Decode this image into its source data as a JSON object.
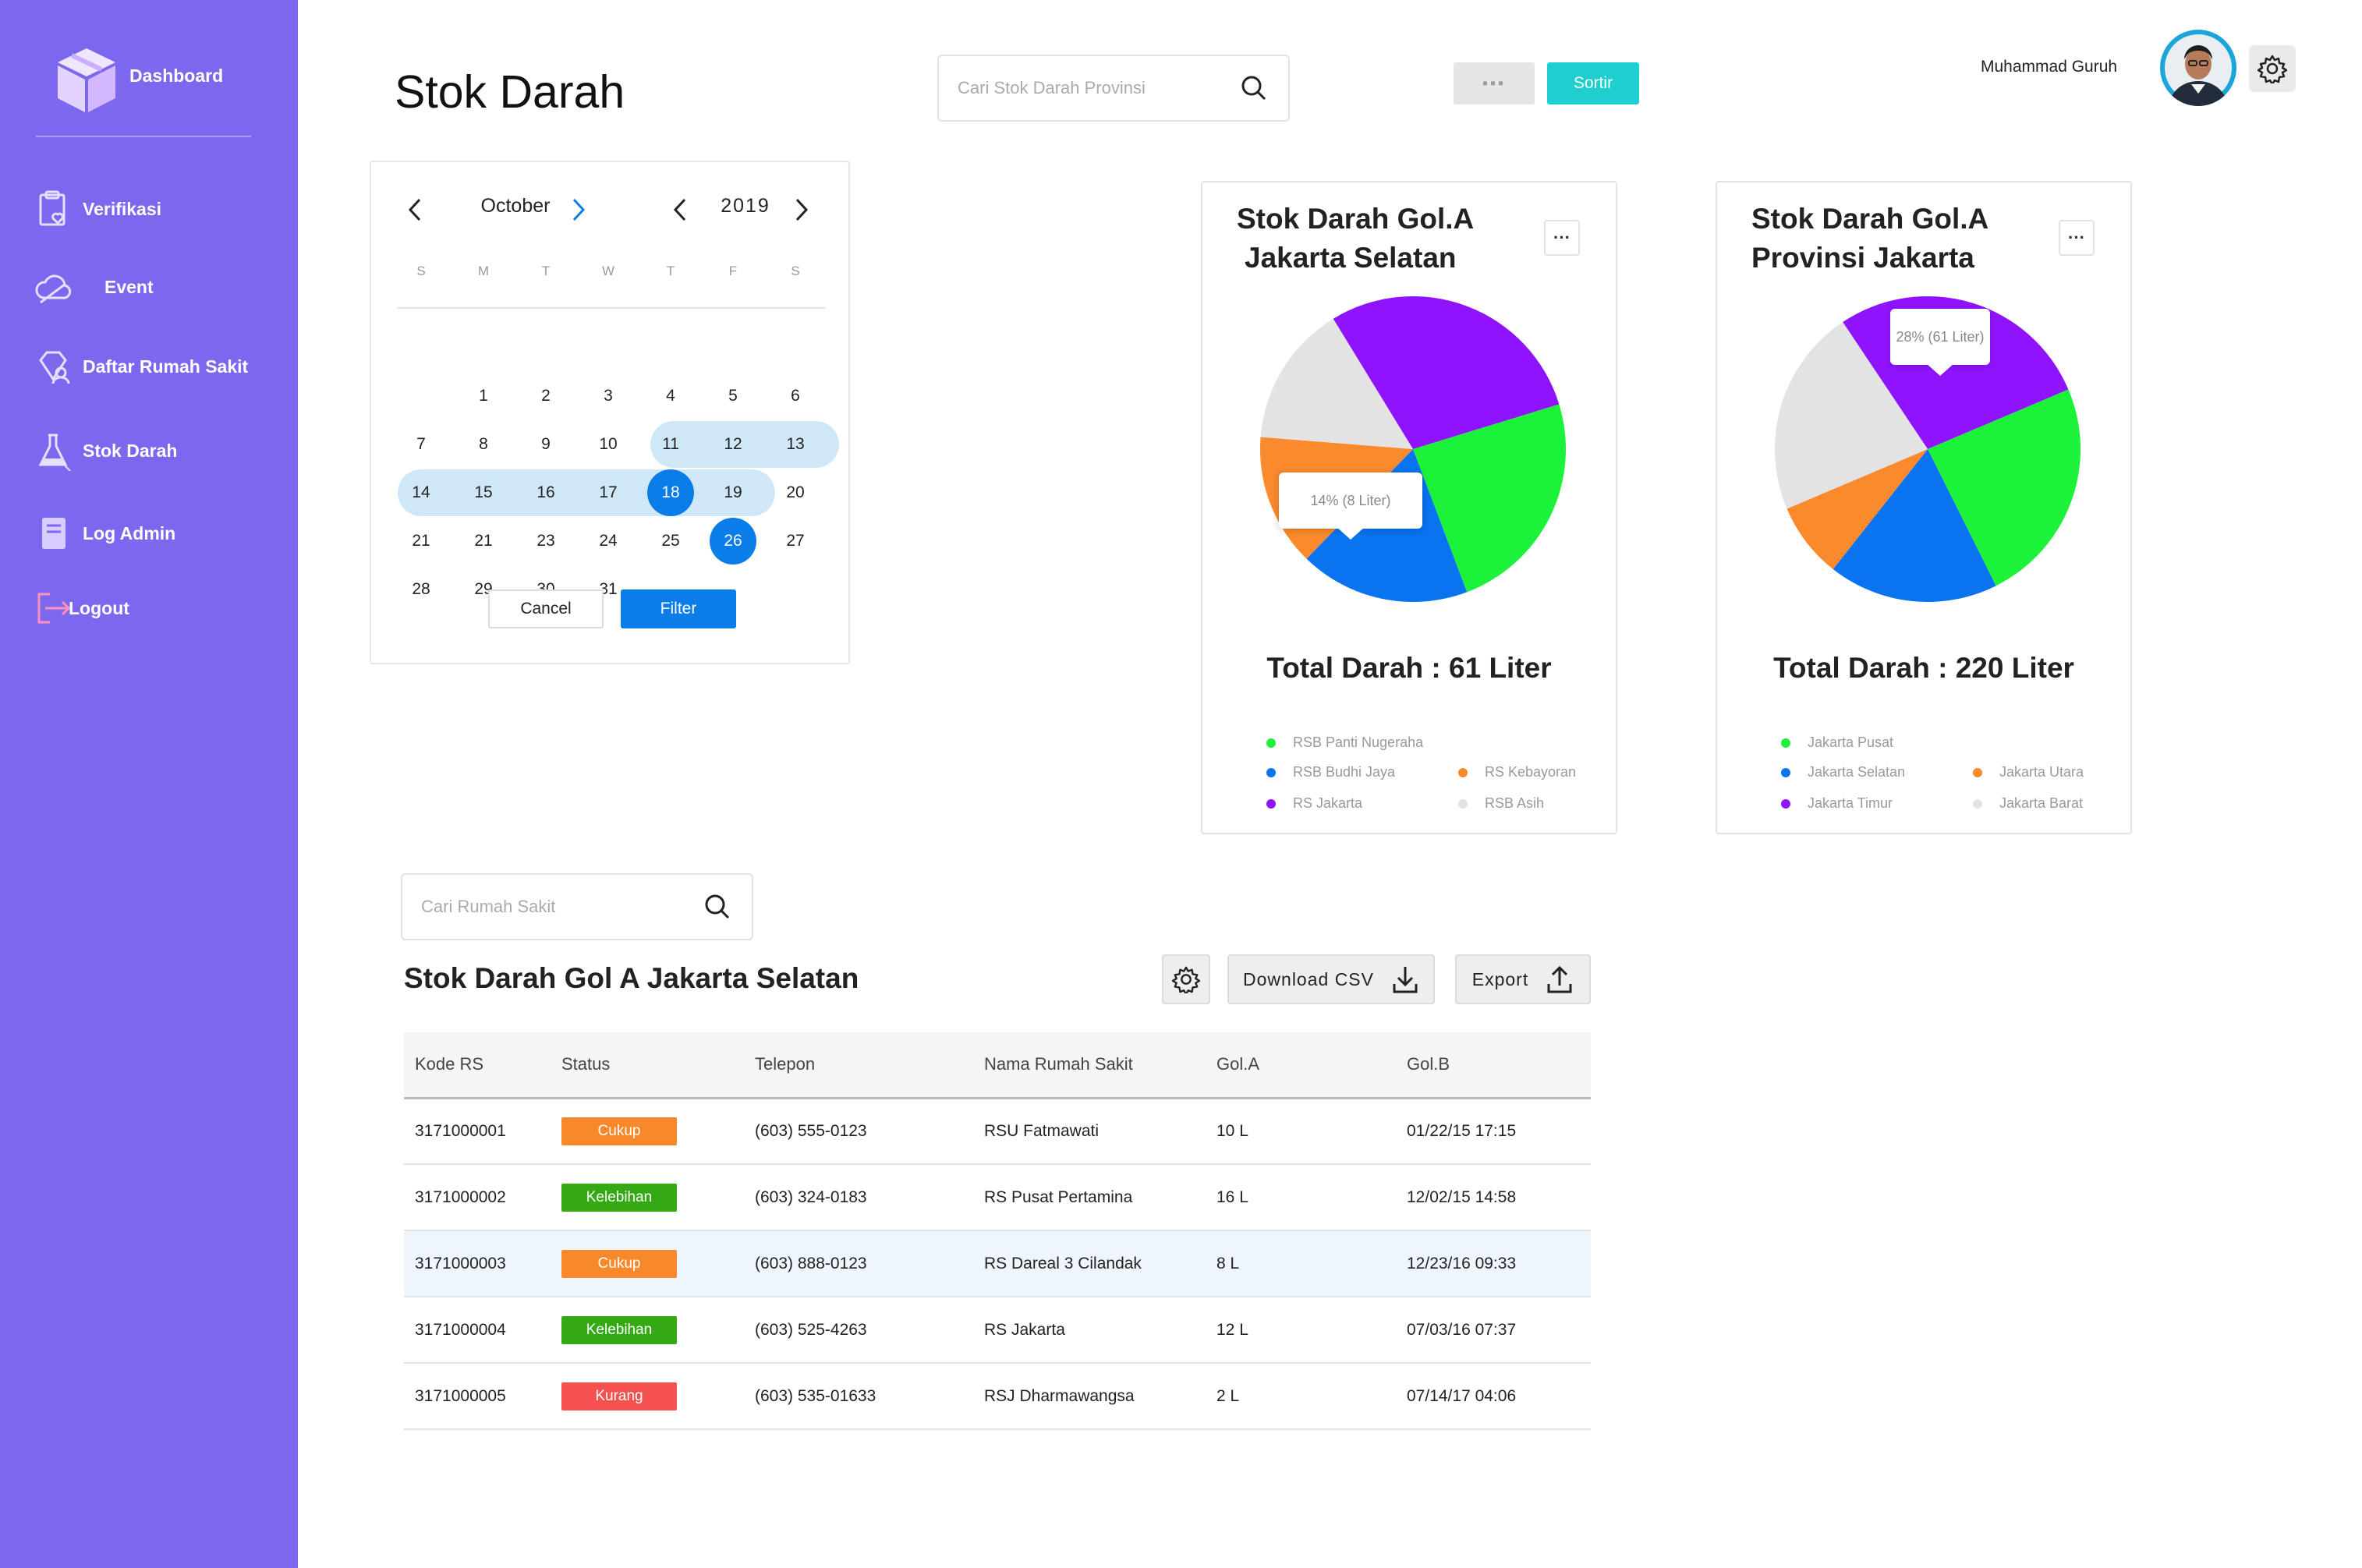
{
  "sidebar": {
    "brand": "Dashboard",
    "items": [
      {
        "label": "Verifikasi",
        "icon": "clipboard-heart-icon"
      },
      {
        "label": "Event",
        "icon": "cloud-icon"
      },
      {
        "label": "Daftar Rumah Sakit",
        "icon": "diamond-user-icon"
      },
      {
        "label": "Stok Darah",
        "icon": "flask-icon"
      },
      {
        "label": "Log Admin",
        "icon": "book-icon"
      },
      {
        "label": "Logout",
        "icon": "logout-icon"
      }
    ],
    "colors": {
      "background": "#7b68ee"
    }
  },
  "header": {
    "title": "Stok Darah",
    "search_placeholder": "Cari Stok Darah Provinsi",
    "toggle_label": "▪▪▪",
    "sort_label": "Sortir",
    "user_name": "Muhammad Guruh"
  },
  "calendar": {
    "month": "October",
    "year": "2019",
    "weekdays": [
      "S",
      "M",
      "T",
      "W",
      "T",
      "F",
      "S"
    ],
    "weeks": [
      [
        "",
        "1",
        "2",
        "3",
        "4",
        "5",
        "6"
      ],
      [
        "7",
        "8",
        "9",
        "10",
        "11",
        "12",
        "13"
      ],
      [
        "14",
        "15",
        "16",
        "17",
        "18",
        "19",
        "20"
      ],
      [
        "21",
        "21",
        "23",
        "24",
        "25",
        "26",
        "27"
      ],
      [
        "28",
        "29",
        "30",
        "31",
        "",
        "",
        ""
      ]
    ],
    "range_start": "18",
    "range_end": "26",
    "cancel_label": "Cancel",
    "filter_label": "Filter"
  },
  "cards": [
    {
      "title_line1": "Stok Darah Gol.A",
      "title_line2": "Jakarta Selatan",
      "more_label": "···",
      "tooltip": "14% (8 Liter)",
      "total": "Total Darah : 61 Liter",
      "legend": [
        {
          "label": "RSB Panti Nugeraha",
          "color": "#1df23a"
        },
        {
          "label": "RSB Budhi Jaya",
          "color": "#0a73f0"
        },
        {
          "label": "RS Kebayoran",
          "color": "#fa8a2c"
        },
        {
          "label": "RS Jakarta",
          "color": "#9013fe"
        },
        {
          "label": "RSB Asih",
          "color": "#e3e3e3"
        }
      ]
    },
    {
      "title_line1": "Stok Darah Gol.A",
      "title_line2": "Provinsi Jakarta",
      "more_label": "···",
      "tooltip": "28% (61 Liter)",
      "total": "Total Darah : 220 Liter",
      "legend": [
        {
          "label": "Jakarta Pusat",
          "color": "#1df23a"
        },
        {
          "label": "Jakarta Selatan",
          "color": "#0a73f0"
        },
        {
          "label": "Jakarta Utara",
          "color": "#fa8a2c"
        },
        {
          "label": "Jakarta Timur",
          "color": "#9013fe"
        },
        {
          "label": "Jakarta Barat",
          "color": "#e3e3e3"
        }
      ]
    }
  ],
  "chart_data": [
    {
      "type": "pie",
      "title": "Stok Darah Gol.A Jakarta Selatan",
      "labels": [
        "RS Jakarta",
        "RSB Panti Nugeraha",
        "RSB Budhi Jaya",
        "RS Kebayoran",
        "RSB Asih"
      ],
      "values": [
        29,
        24,
        18,
        14,
        15
      ],
      "colors": [
        "#9013fe",
        "#1df23a",
        "#0a73f0",
        "#fa8a2c",
        "#e3e3e3"
      ]
    },
    {
      "type": "pie",
      "title": "Stok Darah Gol.A Provinsi Jakarta",
      "labels": [
        "Jakarta Timur",
        "Jakarta Pusat",
        "Jakarta Selatan",
        "Jakarta Utara",
        "Jakarta Barat"
      ],
      "values": [
        28,
        24,
        18,
        8,
        22
      ],
      "colors": [
        "#9013fe",
        "#1df23a",
        "#0a73f0",
        "#fa8a2c",
        "#e3e3e3"
      ]
    }
  ],
  "table_search_placeholder": "Cari Rumah Sakit",
  "table": {
    "title": "Stok Darah Gol A Jakarta Selatan",
    "download_label": "Download CSV",
    "export_label": "Export",
    "columns": [
      "Kode RS",
      "Status",
      "Telepon",
      "Nama Rumah Sakit",
      "Gol.A",
      "Gol.B"
    ],
    "rows": [
      {
        "kode": "3171000001",
        "status": "Cukup",
        "status_color": "#f7892b",
        "telepon": "(603) 555-0123",
        "nama": "RSU Fatmawati",
        "gola": "10 L",
        "golb": "01/22/15 17:15"
      },
      {
        "kode": "3171000002",
        "status": "Kelebihan",
        "status_color": "#35a914",
        "telepon": "(603) 324-0183",
        "nama": "RS Pusat Pertamina",
        "gola": "16 L",
        "golb": "12/02/15 14:58"
      },
      {
        "kode": "3171000003",
        "status": "Cukup",
        "status_color": "#f7892b",
        "telepon": "(603) 888-0123",
        "nama": "RS Dareal 3 Cilandak",
        "gola": "8 L",
        "golb": "12/23/16 09:33"
      },
      {
        "kode": "3171000004",
        "status": "Kelebihan",
        "status_color": "#35a914",
        "telepon": "(603) 525-4263",
        "nama": "RS Jakarta",
        "gola": "12 L",
        "golb": "07/03/16 07:37"
      },
      {
        "kode": "3171000005",
        "status": "Kurang",
        "status_color": "#f65151",
        "telepon": "(603) 535-01633",
        "nama": "RSJ Dharmawangsa",
        "gola": "2 L",
        "golb": "07/14/17 04:06"
      }
    ]
  },
  "colors": {
    "accent": "#0b7de8",
    "sort_button": "#1fcfcf",
    "range": "#cfe8f7"
  }
}
